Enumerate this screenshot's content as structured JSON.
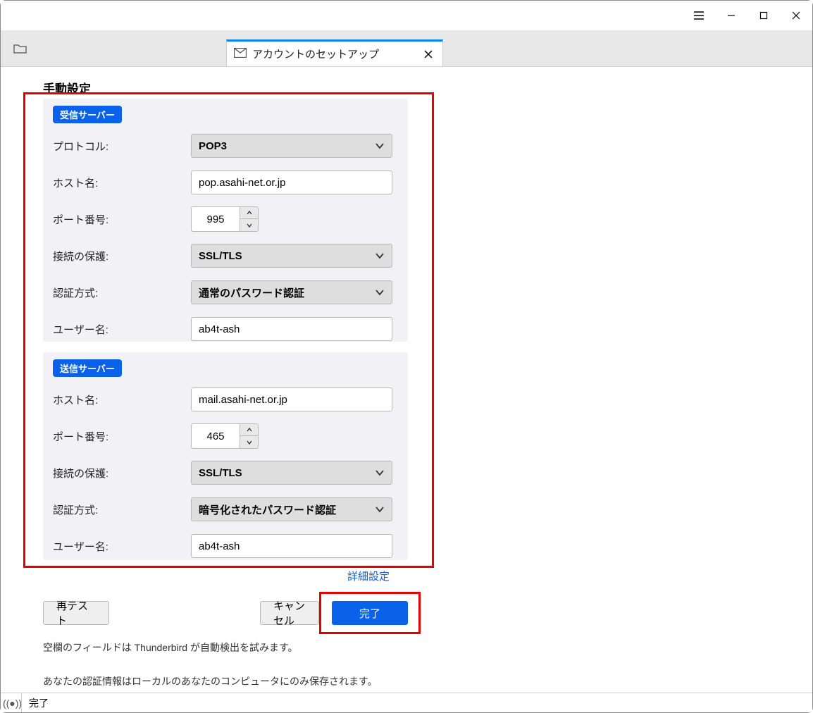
{
  "titlebar": {
    "menu": "☰",
    "minimize": "—",
    "maximize": "□",
    "close": "✕"
  },
  "tab": {
    "title": "アカウントのセットアップ"
  },
  "manual_config": {
    "title": "手動設定"
  },
  "incoming": {
    "badge": "受信サーバー",
    "labels": {
      "protocol": "プロトコル:",
      "hostname": "ホスト名:",
      "port": "ポート番号:",
      "security": "接続の保護:",
      "auth": "認証方式:",
      "username": "ユーザー名:"
    },
    "values": {
      "protocol": "POP3",
      "hostname": "pop.asahi-net.or.jp",
      "port": "995",
      "security": "SSL/TLS",
      "auth": "通常のパスワード認証",
      "username": "ab4t-ash"
    }
  },
  "outgoing": {
    "badge": "送信サーバー",
    "labels": {
      "hostname": "ホスト名:",
      "port": "ポート番号:",
      "security": "接続の保護:",
      "auth": "認証方式:",
      "username": "ユーザー名:"
    },
    "values": {
      "hostname": "mail.asahi-net.or.jp",
      "port": "465",
      "security": "SSL/TLS",
      "auth": "暗号化されたパスワード認証",
      "username": "ab4t-ash"
    }
  },
  "advanced_link": "詳細設定",
  "buttons": {
    "retest": "再テスト",
    "cancel": "キャンセル",
    "done": "完了"
  },
  "note1": "空欄のフィールドは Thunderbird が自動検出を試みます。",
  "note2": "あなたの認証情報はローカルのあなたのコンピュータにのみ保存されます。",
  "statusbar": {
    "text": "完了"
  }
}
